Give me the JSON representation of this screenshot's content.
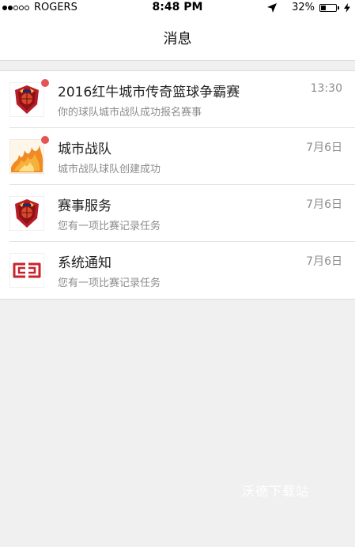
{
  "status_bar": {
    "carrier": "ROGERS",
    "time": "8:48 PM",
    "battery_percent": "32%",
    "battery_level": 0.32,
    "signal_dots_filled": 2,
    "signal_dots_total": 5
  },
  "nav": {
    "title": "消息"
  },
  "messages": [
    {
      "title": "2016红牛城市传奇篮球争霸赛",
      "subtitle": "你的球队城市战队成功报名赛事",
      "time": "13:30",
      "unread": true,
      "icon": "redbull-shield-icon"
    },
    {
      "title": "城市战队",
      "subtitle": "城市战队球队创建成功",
      "time": "7月6日",
      "unread": true,
      "icon": "flame-team-icon"
    },
    {
      "title": "赛事服务",
      "subtitle": "您有一项比赛记录任务",
      "time": "7月6日",
      "unread": false,
      "icon": "redbull-shield-icon"
    },
    {
      "title": "系统通知",
      "subtitle": "您有一项比赛记录任务",
      "time": "7月6日",
      "unread": false,
      "icon": "system-logo-icon"
    }
  ],
  "watermark": "沃德下载站",
  "colors": {
    "badge": "#e55353",
    "accent_red": "#c8232c",
    "background": "#f0f0f0"
  }
}
